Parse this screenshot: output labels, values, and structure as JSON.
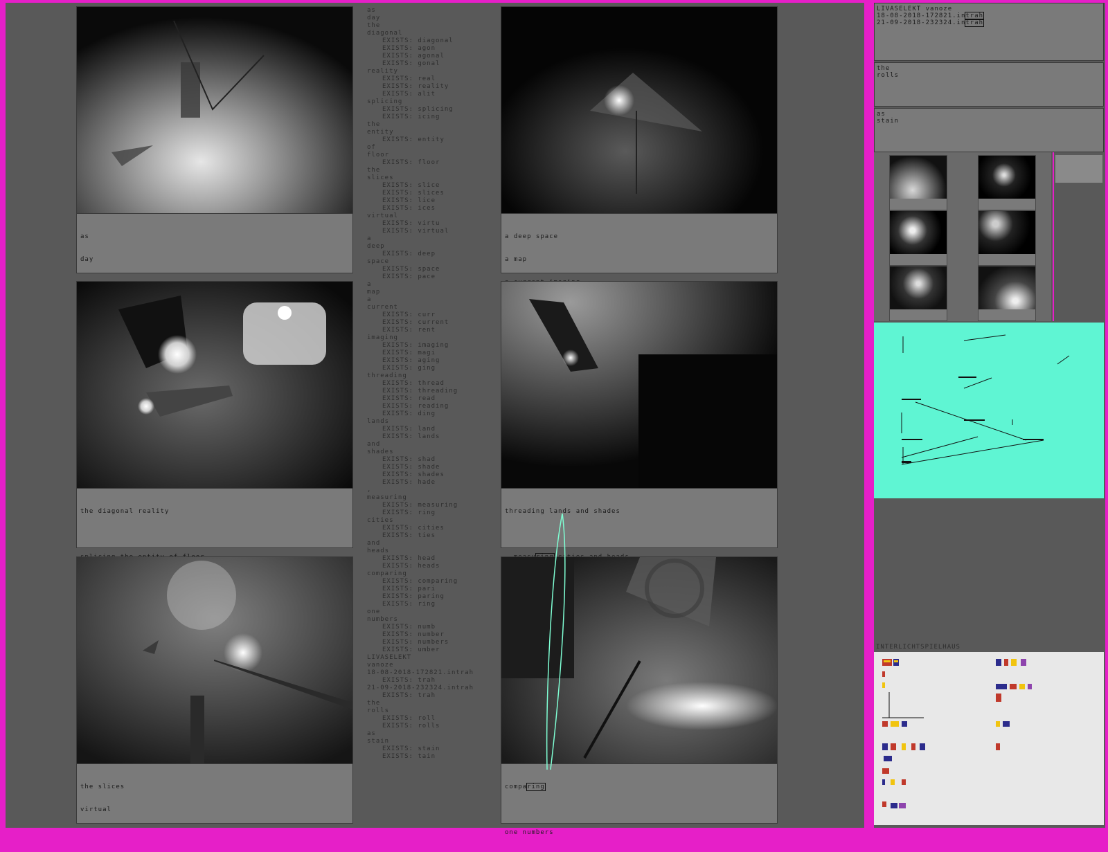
{
  "panels": [
    {
      "id": "p1",
      "caption": [
        "as",
        "day"
      ]
    },
    {
      "id": "p2",
      "caption": [
        "a deep space",
        "a map",
        "a current imaging"
      ]
    },
    {
      "id": "p3",
      "caption": [
        "the diagonal reality",
        "",
        "splicing the entity of floor"
      ]
    },
    {
      "id": "p4",
      "caption": [
        "threading lands and shades",
        ""
      ],
      "caption_line2_pre": ", measu",
      "caption_line2_box": "ring",
      "caption_line2_post": " cities and heads"
    },
    {
      "id": "p5",
      "caption": [
        "the slices",
        "virtual"
      ]
    },
    {
      "id": "p6",
      "caption_line1_pre": "compa",
      "caption_line1_box": "ring",
      "caption_line2": "one numbers"
    }
  ],
  "poem": [
    {
      "t": "as",
      "ex": false
    },
    {
      "t": "day",
      "ex": false
    },
    {
      "t": "the",
      "ex": false
    },
    {
      "t": "diagonal",
      "ex": false
    },
    {
      "t": "EXISTS: diagonal",
      "ex": true
    },
    {
      "t": "EXISTS: agon",
      "ex": true
    },
    {
      "t": "EXISTS: agonal",
      "ex": true
    },
    {
      "t": "EXISTS: gonal",
      "ex": true
    },
    {
      "t": "reality",
      "ex": false
    },
    {
      "t": "EXISTS: real",
      "ex": true
    },
    {
      "t": "EXISTS: reality",
      "ex": true
    },
    {
      "t": "EXISTS: alit",
      "ex": true
    },
    {
      "t": "splicing",
      "ex": false
    },
    {
      "t": "EXISTS: splicing",
      "ex": true
    },
    {
      "t": "EXISTS: icing",
      "ex": true
    },
    {
      "t": "the",
      "ex": false
    },
    {
      "t": "entity",
      "ex": false
    },
    {
      "t": "EXISTS: entity",
      "ex": true
    },
    {
      "t": "of",
      "ex": false
    },
    {
      "t": "floor",
      "ex": false
    },
    {
      "t": "EXISTS: floor",
      "ex": true
    },
    {
      "t": "the",
      "ex": false
    },
    {
      "t": "slices",
      "ex": false
    },
    {
      "t": "EXISTS: slice",
      "ex": true
    },
    {
      "t": "EXISTS: slices",
      "ex": true
    },
    {
      "t": "EXISTS: lice",
      "ex": true
    },
    {
      "t": "EXISTS: ices",
      "ex": true
    },
    {
      "t": "virtual",
      "ex": false
    },
    {
      "t": "EXISTS: virtu",
      "ex": true
    },
    {
      "t": "EXISTS: virtual",
      "ex": true
    },
    {
      "t": "a",
      "ex": false
    },
    {
      "t": "deep",
      "ex": false
    },
    {
      "t": "EXISTS: deep",
      "ex": true
    },
    {
      "t": "space",
      "ex": false
    },
    {
      "t": "EXISTS: space",
      "ex": true
    },
    {
      "t": "EXISTS: pace",
      "ex": true
    },
    {
      "t": "a",
      "ex": false
    },
    {
      "t": "map",
      "ex": false
    },
    {
      "t": "a",
      "ex": false
    },
    {
      "t": "current",
      "ex": false
    },
    {
      "t": "EXISTS: curr",
      "ex": true
    },
    {
      "t": "EXISTS: current",
      "ex": true
    },
    {
      "t": "EXISTS: rent",
      "ex": true
    },
    {
      "t": "imaging",
      "ex": false
    },
    {
      "t": "EXISTS: imaging",
      "ex": true
    },
    {
      "t": "EXISTS: magi",
      "ex": true
    },
    {
      "t": "EXISTS: aging",
      "ex": true
    },
    {
      "t": "EXISTS: ging",
      "ex": true
    },
    {
      "t": "threading",
      "ex": false
    },
    {
      "t": "EXISTS: thread",
      "ex": true
    },
    {
      "t": "EXISTS: threading",
      "ex": true
    },
    {
      "t": "EXISTS: read",
      "ex": true
    },
    {
      "t": "EXISTS: reading",
      "ex": true
    },
    {
      "t": "EXISTS: ding",
      "ex": true
    },
    {
      "t": "lands",
      "ex": false
    },
    {
      "t": "EXISTS: land",
      "ex": true
    },
    {
      "t": "EXISTS: lands",
      "ex": true
    },
    {
      "t": "and",
      "ex": false
    },
    {
      "t": "shades",
      "ex": false
    },
    {
      "t": "EXISTS: shad",
      "ex": true
    },
    {
      "t": "EXISTS: shade",
      "ex": true
    },
    {
      "t": "EXISTS: shades",
      "ex": true
    },
    {
      "t": "EXISTS: hade",
      "ex": true
    },
    {
      "t": ",",
      "ex": false
    },
    {
      "t": "measuring",
      "ex": false
    },
    {
      "t": "EXISTS: measuring",
      "ex": true
    },
    {
      "t": "EXISTS: ring",
      "ex": true
    },
    {
      "t": "cities",
      "ex": false
    },
    {
      "t": "EXISTS: cities",
      "ex": true
    },
    {
      "t": "EXISTS: ties",
      "ex": true
    },
    {
      "t": "and",
      "ex": false
    },
    {
      "t": "heads",
      "ex": false
    },
    {
      "t": "EXISTS: head",
      "ex": true
    },
    {
      "t": "EXISTS: heads",
      "ex": true
    },
    {
      "t": "comparing",
      "ex": false
    },
    {
      "t": "EXISTS: comparing",
      "ex": true
    },
    {
      "t": "EXISTS: pari",
      "ex": true
    },
    {
      "t": "EXISTS: paring",
      "ex": true
    },
    {
      "t": "EXISTS: ring",
      "ex": true
    },
    {
      "t": "one",
      "ex": false
    },
    {
      "t": "numbers",
      "ex": false
    },
    {
      "t": "EXISTS: numb",
      "ex": true
    },
    {
      "t": "EXISTS: number",
      "ex": true
    },
    {
      "t": "EXISTS: numbers",
      "ex": true
    },
    {
      "t": "EXISTS: umber",
      "ex": true
    },
    {
      "t": "LIVASELEKT",
      "ex": false
    },
    {
      "t": "vanoze",
      "ex": false
    },
    {
      "t": "18-08-2018-172821.intrah",
      "ex": false
    },
    {
      "t": "EXISTS: trah",
      "ex": true
    },
    {
      "t": "21-09-2018-232324.intrah",
      "ex": false
    },
    {
      "t": "EXISTS: trah",
      "ex": true
    },
    {
      "t": "the",
      "ex": false
    },
    {
      "t": "rolls",
      "ex": false
    },
    {
      "t": "EXISTS: roll",
      "ex": true
    },
    {
      "t": "EXISTS: rolls",
      "ex": true
    },
    {
      "t": "as",
      "ex": false
    },
    {
      "t": "stain",
      "ex": false
    },
    {
      "t": "EXISTS: stain",
      "ex": true
    },
    {
      "t": "EXISTS: tain",
      "ex": true
    }
  ],
  "sidebar": {
    "title": "LIVASELEKT vanoze",
    "file1_pre": "18-08-2018-172821.in",
    "file1_box": "trah",
    "file2_pre": "21-09-2018-232324.in",
    "file2_box": "trah",
    "box2": [
      "the",
      "rolls"
    ],
    "box3": [
      "as",
      "stain"
    ],
    "inter_label": "INTERLICHTSPIELHAUS"
  },
  "colors": {
    "frame": "#e61fc8",
    "background": "#595959",
    "caption": "#7a7a7a",
    "map": "#5ff5d3",
    "link": "#7fffd4",
    "inter": "#e8e8e8"
  }
}
